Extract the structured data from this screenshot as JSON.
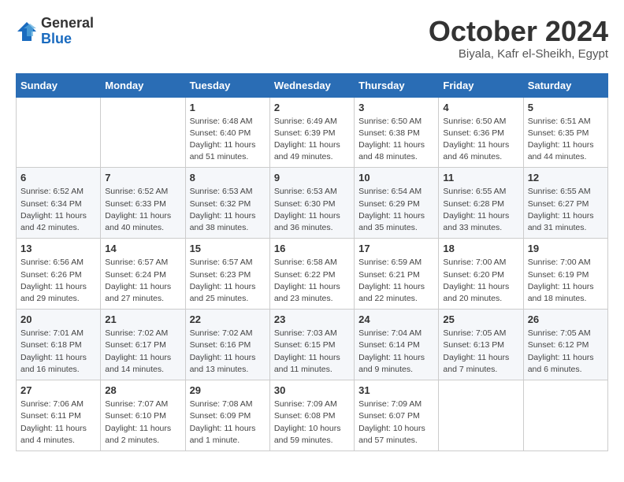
{
  "header": {
    "logo_line1": "General",
    "logo_line2": "Blue",
    "month": "October 2024",
    "location": "Biyala, Kafr el-Sheikh, Egypt"
  },
  "weekdays": [
    "Sunday",
    "Monday",
    "Tuesday",
    "Wednesday",
    "Thursday",
    "Friday",
    "Saturday"
  ],
  "weeks": [
    [
      {
        "day": "",
        "info": ""
      },
      {
        "day": "",
        "info": ""
      },
      {
        "day": "1",
        "info": "Sunrise: 6:48 AM\nSunset: 6:40 PM\nDaylight: 11 hours and 51 minutes."
      },
      {
        "day": "2",
        "info": "Sunrise: 6:49 AM\nSunset: 6:39 PM\nDaylight: 11 hours and 49 minutes."
      },
      {
        "day": "3",
        "info": "Sunrise: 6:50 AM\nSunset: 6:38 PM\nDaylight: 11 hours and 48 minutes."
      },
      {
        "day": "4",
        "info": "Sunrise: 6:50 AM\nSunset: 6:36 PM\nDaylight: 11 hours and 46 minutes."
      },
      {
        "day": "5",
        "info": "Sunrise: 6:51 AM\nSunset: 6:35 PM\nDaylight: 11 hours and 44 minutes."
      }
    ],
    [
      {
        "day": "6",
        "info": "Sunrise: 6:52 AM\nSunset: 6:34 PM\nDaylight: 11 hours and 42 minutes."
      },
      {
        "day": "7",
        "info": "Sunrise: 6:52 AM\nSunset: 6:33 PM\nDaylight: 11 hours and 40 minutes."
      },
      {
        "day": "8",
        "info": "Sunrise: 6:53 AM\nSunset: 6:32 PM\nDaylight: 11 hours and 38 minutes."
      },
      {
        "day": "9",
        "info": "Sunrise: 6:53 AM\nSunset: 6:30 PM\nDaylight: 11 hours and 36 minutes."
      },
      {
        "day": "10",
        "info": "Sunrise: 6:54 AM\nSunset: 6:29 PM\nDaylight: 11 hours and 35 minutes."
      },
      {
        "day": "11",
        "info": "Sunrise: 6:55 AM\nSunset: 6:28 PM\nDaylight: 11 hours and 33 minutes."
      },
      {
        "day": "12",
        "info": "Sunrise: 6:55 AM\nSunset: 6:27 PM\nDaylight: 11 hours and 31 minutes."
      }
    ],
    [
      {
        "day": "13",
        "info": "Sunrise: 6:56 AM\nSunset: 6:26 PM\nDaylight: 11 hours and 29 minutes."
      },
      {
        "day": "14",
        "info": "Sunrise: 6:57 AM\nSunset: 6:24 PM\nDaylight: 11 hours and 27 minutes."
      },
      {
        "day": "15",
        "info": "Sunrise: 6:57 AM\nSunset: 6:23 PM\nDaylight: 11 hours and 25 minutes."
      },
      {
        "day": "16",
        "info": "Sunrise: 6:58 AM\nSunset: 6:22 PM\nDaylight: 11 hours and 23 minutes."
      },
      {
        "day": "17",
        "info": "Sunrise: 6:59 AM\nSunset: 6:21 PM\nDaylight: 11 hours and 22 minutes."
      },
      {
        "day": "18",
        "info": "Sunrise: 7:00 AM\nSunset: 6:20 PM\nDaylight: 11 hours and 20 minutes."
      },
      {
        "day": "19",
        "info": "Sunrise: 7:00 AM\nSunset: 6:19 PM\nDaylight: 11 hours and 18 minutes."
      }
    ],
    [
      {
        "day": "20",
        "info": "Sunrise: 7:01 AM\nSunset: 6:18 PM\nDaylight: 11 hours and 16 minutes."
      },
      {
        "day": "21",
        "info": "Sunrise: 7:02 AM\nSunset: 6:17 PM\nDaylight: 11 hours and 14 minutes."
      },
      {
        "day": "22",
        "info": "Sunrise: 7:02 AM\nSunset: 6:16 PM\nDaylight: 11 hours and 13 minutes."
      },
      {
        "day": "23",
        "info": "Sunrise: 7:03 AM\nSunset: 6:15 PM\nDaylight: 11 hours and 11 minutes."
      },
      {
        "day": "24",
        "info": "Sunrise: 7:04 AM\nSunset: 6:14 PM\nDaylight: 11 hours and 9 minutes."
      },
      {
        "day": "25",
        "info": "Sunrise: 7:05 AM\nSunset: 6:13 PM\nDaylight: 11 hours and 7 minutes."
      },
      {
        "day": "26",
        "info": "Sunrise: 7:05 AM\nSunset: 6:12 PM\nDaylight: 11 hours and 6 minutes."
      }
    ],
    [
      {
        "day": "27",
        "info": "Sunrise: 7:06 AM\nSunset: 6:11 PM\nDaylight: 11 hours and 4 minutes."
      },
      {
        "day": "28",
        "info": "Sunrise: 7:07 AM\nSunset: 6:10 PM\nDaylight: 11 hours and 2 minutes."
      },
      {
        "day": "29",
        "info": "Sunrise: 7:08 AM\nSunset: 6:09 PM\nDaylight: 11 hours and 1 minute."
      },
      {
        "day": "30",
        "info": "Sunrise: 7:09 AM\nSunset: 6:08 PM\nDaylight: 10 hours and 59 minutes."
      },
      {
        "day": "31",
        "info": "Sunrise: 7:09 AM\nSunset: 6:07 PM\nDaylight: 10 hours and 57 minutes."
      },
      {
        "day": "",
        "info": ""
      },
      {
        "day": "",
        "info": ""
      }
    ]
  ]
}
